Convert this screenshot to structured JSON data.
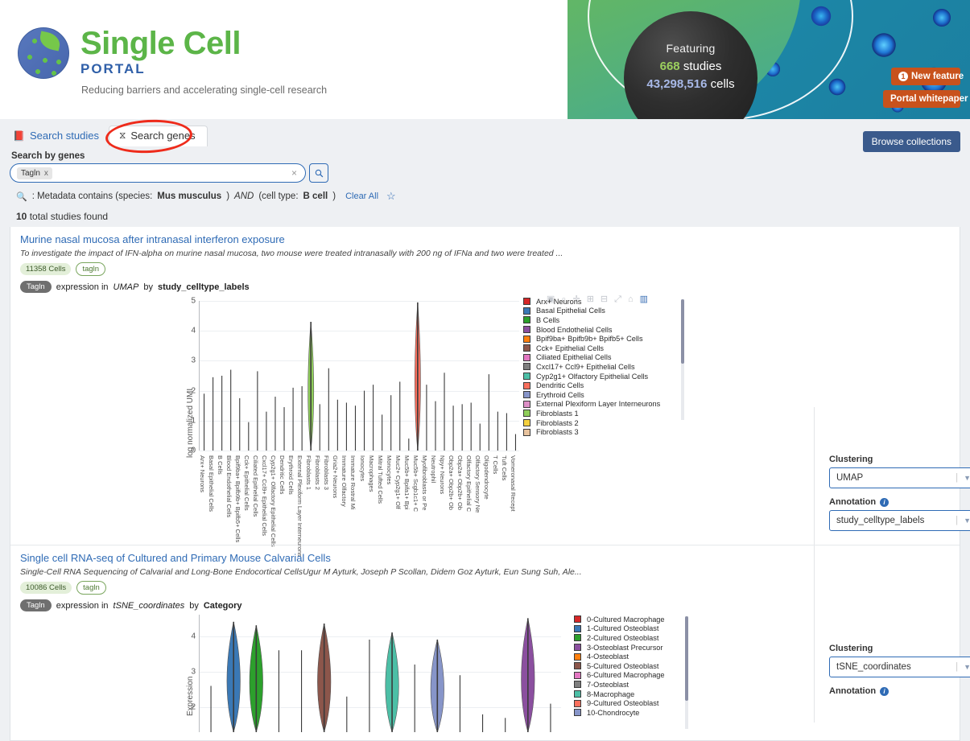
{
  "hero": {
    "logo_title": "Single Cell",
    "logo_sub": "PORTAL",
    "tagline": "Reducing barriers and accelerating single-cell research",
    "featuring_label": "Featuring",
    "studies_count": "668",
    "studies_word": "studies",
    "cells_count": "43,298,516",
    "cells_word": "cells",
    "new_feature_badge": "1",
    "new_feature_label": "New feature",
    "whitepaper_label": "Portal whitepaper"
  },
  "tabs": [
    {
      "label": "Search studies",
      "icon": "book-icon",
      "active": false
    },
    {
      "label": "Search genes",
      "icon": "dna-icon",
      "active": true
    }
  ],
  "search": {
    "section_label": "Search by genes",
    "gene_chip": "Tagln",
    "chip_remove": "x",
    "clear_icon": "×",
    "search_icon": "search-icon",
    "filter_prefix": ": Metadata contains (species:",
    "filter_species": "Mus musculus",
    "filter_and": "AND",
    "filter_celltype_prefix": "(cell type:",
    "filter_celltype": "B cell",
    "filter_suffix": ")",
    "clear_all": "Clear All",
    "star_icon": "star-outline-icon",
    "browse_collections": "Browse collections"
  },
  "results": {
    "total_count": "10",
    "total_label": "total studies found"
  },
  "studies": [
    {
      "title": "Murine nasal mucosa after intranasal interferon exposure",
      "description": "To investigate the impact of IFN-alpha on murine nasal mucosa, two mouse were treated intranasally with 200 ng of IFNa and two were treated ...",
      "cells_badge": "11358 Cells",
      "gene_badge": "tagln",
      "gene_pill": "Tagln",
      "expr_prefix": "expression in",
      "expr_cluster": "UMAP",
      "expr_by": "by",
      "expr_annotation": "study_celltype_labels",
      "clustering_label": "Clustering",
      "clustering_value": "UMAP",
      "annotation_label": "Annotation",
      "annotation_value": "study_celltype_labels"
    },
    {
      "title": "Single cell RNA-seq of Cultured and Primary Mouse Calvarial Cells",
      "description": "Single-Cell RNA Sequencing of Calvarial and Long-Bone Endocortical CellsUgur M Ayturk, Joseph P Scollan, Didem Goz Ayturk, Eun Sung Suh, Ale...",
      "cells_badge": "10086 Cells",
      "gene_badge": "tagln",
      "gene_pill": "Tagln",
      "expr_prefix": "expression in",
      "expr_cluster": "tSNE_coordinates",
      "expr_by": "by",
      "expr_annotation": "Category",
      "clustering_label": "Clustering",
      "clustering_value": "tSNE_coordinates",
      "annotation_label": "Annotation",
      "annotation_value": ""
    }
  ],
  "modebar": [
    {
      "name": "camera-icon",
      "glyph": "▣"
    },
    {
      "name": "zoom-icon",
      "glyph": "⌕"
    },
    {
      "name": "pan-icon",
      "glyph": "✛"
    },
    {
      "name": "zoom-in-icon",
      "glyph": "⊞"
    },
    {
      "name": "zoom-out-icon",
      "glyph": "⊟"
    },
    {
      "name": "autoscale-icon",
      "glyph": "⤢"
    },
    {
      "name": "reset-axes-icon",
      "glyph": "⌂"
    },
    {
      "name": "toggle-spike-icon",
      "glyph": "▥"
    }
  ],
  "chart_data": [
    {
      "type": "violin",
      "title": "Tagln expression in UMAP by study_celltype_labels",
      "ylabel": "log normalized UMI",
      "xlabel": "",
      "ylim": [
        0,
        5
      ],
      "yticks": [
        0,
        1,
        2,
        3,
        4,
        5
      ],
      "grid": true,
      "legend_position": "right",
      "categories": [
        "Arx+ Neurons",
        "Basal Epithelial Cells",
        "B Cells",
        "Blood Endothelial Cells",
        "Bpif9ba+ Bpifb9b+ Bpifb5+ Cells",
        "Cck+ Epithelial Cells",
        "Ciliated Epithelial Cells",
        "Cxcl17+ Ccl9+ Epithelial Cells",
        "Cyp2g1+ Olfactory Epithelial Cells",
        "Dendritic Cells",
        "Erythroid Cells",
        "External Plexiform Layer Interneurons",
        "Fibroblasts 1",
        "Fibroblasts 2",
        "Fibroblasts 3",
        "Gria2+ Neurons",
        "Immature Olfactory",
        "Immature Rostral Mi",
        "Ionocytes",
        "Macrophages",
        "Mitral Tufted Cells",
        "Monocytes",
        "Muc2+ Cyp2g1+ Olf",
        "Muc5b+ Bpifa1+ Bpi",
        "Muc5b+ Scgb1c1+ C",
        "Myofibroblasts or Pe",
        "Neutrophil",
        "Npy+ Neurons",
        "Obp2a+ Obp2b+ Ob",
        "Obp2a+ Obp2b+ Ob",
        "Olfactory Epithelial C",
        "Olfactory Sensory Ne",
        "Oligodendrocyte",
        "T Cells",
        "Tuft Cells",
        "Vomeronasal Recept"
      ],
      "legend": [
        {
          "label": "Arx+ Neurons",
          "color": "#d62728"
        },
        {
          "label": "Basal Epithelial Cells",
          "color": "#3a78b5"
        },
        {
          "label": "B Cells",
          "color": "#2ca02c"
        },
        {
          "label": "Blood Endothelial Cells",
          "color": "#8b4f9f"
        },
        {
          "label": "Bpif9ba+ Bpifb9b+ Bpifb5+ Cells",
          "color": "#ff7f0e"
        },
        {
          "label": "Cck+ Epithelial Cells",
          "color": "#8c564b"
        },
        {
          "label": "Ciliated Epithelial Cells",
          "color": "#e377c2"
        },
        {
          "label": "Cxcl17+ Ccl9+ Epithelial Cells",
          "color": "#7f7f7f"
        },
        {
          "label": "Cyp2g1+ Olfactory Epithelial Cells",
          "color": "#4cbfa6"
        },
        {
          "label": "Dendritic Cells",
          "color": "#f96f5d"
        },
        {
          "label": "Erythroid Cells",
          "color": "#8795c9"
        },
        {
          "label": "External Plexiform Layer Interneurons",
          "color": "#dd8fc6"
        },
        {
          "label": "Fibroblasts 1",
          "color": "#8fce5a"
        },
        {
          "label": "Fibroblasts 2",
          "color": "#f4d03f"
        },
        {
          "label": "Fibroblasts 3",
          "color": "#e8c39e"
        }
      ],
      "violin_peaks": [
        1.9,
        2.45,
        2.5,
        2.7,
        1.75,
        0.95,
        2.65,
        1.3,
        1.8,
        1.45,
        2.1,
        2.15,
        4.3,
        1.55,
        2.75,
        1.7,
        1.6,
        1.5,
        2.0,
        2.2,
        1.2,
        1.85,
        2.3,
        0.4,
        4.95,
        2.2,
        1.65,
        2.6,
        1.5,
        1.55,
        1.6,
        0.9,
        2.55,
        1.3,
        1.25,
        0.55
      ]
    },
    {
      "type": "violin",
      "title": "Tagln expression in tSNE_coordinates by Category",
      "ylabel": "Expression",
      "xlabel": "",
      "ylim": [
        1.3,
        4.6
      ],
      "yticks": [
        2,
        3,
        4
      ],
      "grid": true,
      "legend_position": "right",
      "legend": [
        {
          "label": "0-Cultured Macrophage",
          "color": "#d62728"
        },
        {
          "label": "1-Cultured Osteoblast",
          "color": "#3a78b5"
        },
        {
          "label": "2-Cultured Osteoblast",
          "color": "#2ca02c"
        },
        {
          "label": "3-Osteoblast Precursor",
          "color": "#8b4f9f"
        },
        {
          "label": "4-Osteoblast",
          "color": "#ff7f0e"
        },
        {
          "label": "5-Cultured Osteoblast",
          "color": "#8c564b"
        },
        {
          "label": "6-Cultured Macrophage",
          "color": "#e377c2"
        },
        {
          "label": "7-Osteoblast",
          "color": "#7f7f7f"
        },
        {
          "label": "8-Macrophage",
          "color": "#4cbfa6"
        },
        {
          "label": "9-Cultured Osteoblast",
          "color": "#f96f5d"
        },
        {
          "label": "10-Chondrocyte",
          "color": "#8795c9"
        }
      ],
      "violin_peaks": [
        2.6,
        4.4,
        4.3,
        3.6,
        3.6,
        4.35,
        2.3,
        3.9,
        4.1,
        3.2,
        3.9,
        2.9,
        1.8,
        1.7,
        4.5,
        2.1
      ]
    }
  ]
}
